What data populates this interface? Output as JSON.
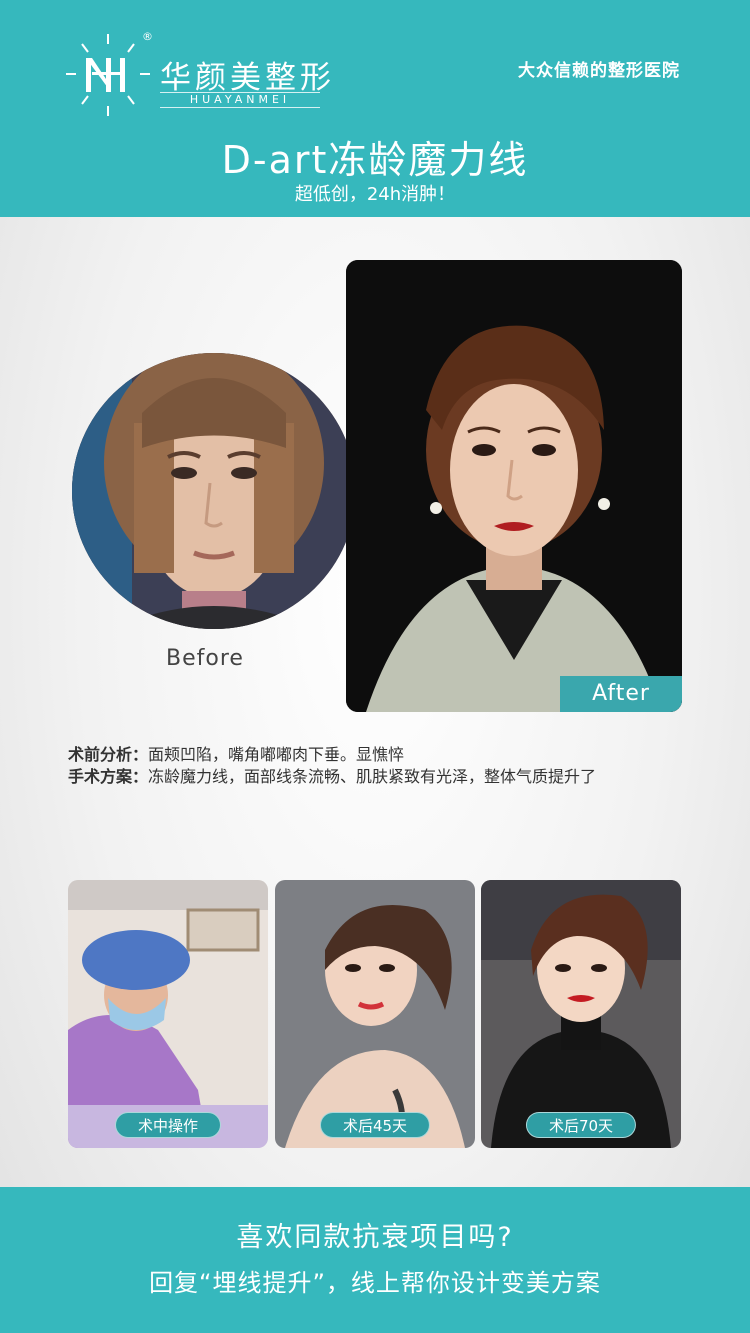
{
  "header": {
    "logo_name": "华颜美整形",
    "logo_sub": "HUAYANMEI",
    "logo_reg": "®",
    "slogan": "大众信赖的整形医院",
    "title": "D-art冻龄魔力线",
    "subtitle": "超低创，24h消肿！"
  },
  "compare": {
    "before_label": "Before",
    "after_label": "After"
  },
  "analysis": {
    "pre_key": "术前分析：",
    "pre_value": "面颊凹陷，嘴角嘟嘟肉下垂。显憔悴",
    "plan_key": "手术方案：",
    "plan_value": "冻龄魔力线，面部线条流畅、肌肤紧致有光泽，整体气质提升了"
  },
  "gallery": [
    {
      "label": "术中操作"
    },
    {
      "label": "术后45天"
    },
    {
      "label": "术后70天"
    }
  ],
  "footer": {
    "question": "喜欢同款抗衰项目吗?",
    "answer": "回复“埋线提升”，线上帮你设计变美方案"
  },
  "colors": {
    "brand_teal": "#36b8bd",
    "label_teal": "#2f9ea4"
  }
}
